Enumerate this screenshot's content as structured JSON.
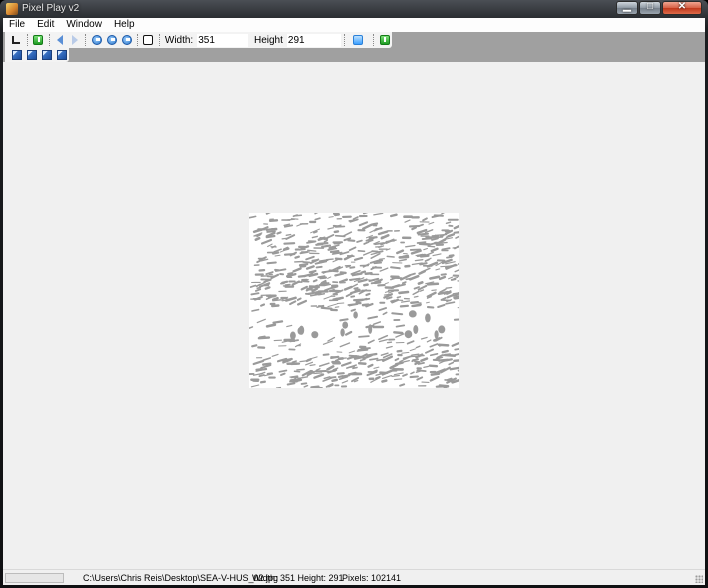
{
  "window": {
    "title": "Pixel Play v2"
  },
  "menu": [
    "File",
    "Edit",
    "Window",
    "Help"
  ],
  "toolbar": {
    "width_label": "Width:",
    "width_value": "351",
    "height_label": "Height",
    "height_value": "291",
    "icons": [
      "crop-icon",
      "green-action-icon",
      "flip-left-icon",
      "flip-right-icon",
      "rotate-icon",
      "rotate-icon",
      "rotate-icon",
      "square-select-icon",
      "blue-tool-icon",
      "green-tool-icon"
    ],
    "filter_icons": [
      "filter-icon-1",
      "filter-icon-2",
      "filter-icon-3",
      "filter-icon-4"
    ]
  },
  "status": {
    "progress": 0,
    "path": "C:\\Users\\Chris Reis\\Desktop\\SEA-V-HUS_02.jpg",
    "dimensions": "Width: 351 Height: 291",
    "pixels": "Pixels: 102141"
  },
  "colors": {
    "image_gray": "#9a9a9a",
    "toolbar_bg": "#a0a0a0"
  }
}
